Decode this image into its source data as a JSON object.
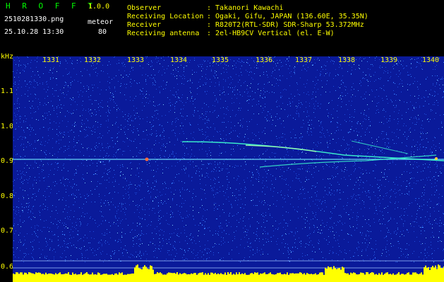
{
  "app": {
    "title": "H R O F F T",
    "version": "1.0.0",
    "filename": "2510281330.png",
    "datetime": "25.10.28 13:30",
    "meteor_label": "meteor",
    "meteor_count": "80"
  },
  "info": {
    "labels": [
      "Observer",
      "Receiving Location",
      "Receiver",
      "Receiving antenna"
    ],
    "values": [
      ": Takanori Kawachi",
      ": Ogaki, Gifu, JAPAN (136.60E, 35.35N)",
      ": R820T2(RTL-SDR) SDR-Sharp 53.372MHz",
      ": 2el-HB9CV Vertical (el. E-W)"
    ]
  },
  "axis": {
    "y_unit": "kHz",
    "y_ticks": [
      "1.1",
      "1.0",
      "0.9",
      "0.8",
      "0.7",
      "0.6"
    ],
    "x_ticks": [
      "1331",
      "1332",
      "1333",
      "1334",
      "1335",
      "1336",
      "1337",
      "1338",
      "1339",
      "1340"
    ]
  },
  "colors": {
    "background": "#000000",
    "header_text": "#ffff00",
    "title": "#00ff00",
    "waterfall_bg": "#0a1a9a",
    "noise": "#3a86ff",
    "trace": "#3dffd0",
    "level_bar": "#ffff00",
    "baseline": "#00e5ff"
  }
}
